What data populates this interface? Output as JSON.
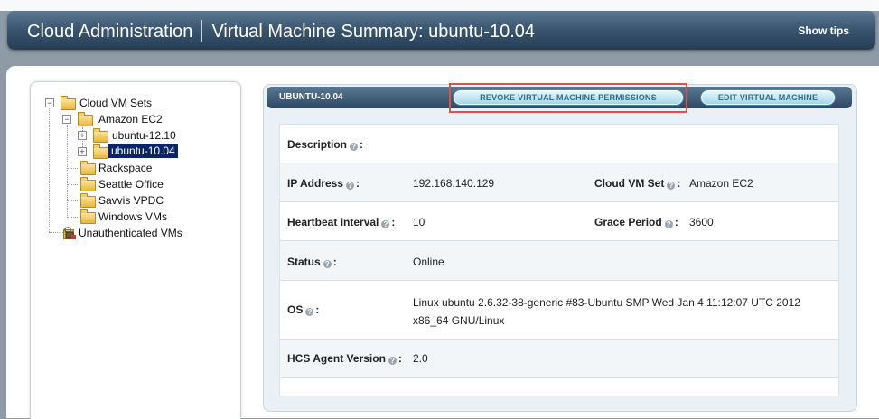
{
  "header": {
    "app_title": "Cloud Administration",
    "page_title": "Virtual Machine Summary: ubuntu-10.04",
    "show_tips": "Show tips"
  },
  "tree": {
    "cloud_vm_sets": "Cloud VM Sets",
    "amazon_ec2": "Amazon EC2",
    "ubuntu_1210": "ubuntu-12.10",
    "ubuntu_1004": "ubuntu-10.04",
    "rackspace": "Rackspace",
    "seattle_office": "Seattle Office",
    "savvis_vpdc": "Savvis VPDC",
    "windows_vms": "Windows VMs",
    "unauthenticated_vms": "Unauthenticated VMs"
  },
  "panel": {
    "title": "UBUNTU-10.04",
    "revoke_button": "REVOKE VIRTUAL MACHINE PERMISSIONS",
    "edit_button": "EDIT VIRTUAL MACHINE"
  },
  "details": {
    "description_label": "Description",
    "description_value": "",
    "ip_label": "IP Address",
    "ip_value": "192.168.140.129",
    "vmset_label": "Cloud VM Set",
    "vmset_value": "Amazon EC2",
    "heartbeat_label": "Heartbeat Interval",
    "heartbeat_value": "10",
    "grace_label": "Grace Period",
    "grace_value": "3600",
    "status_label": "Status",
    "status_value": "Online",
    "os_label": "OS",
    "os_value_line1": "Linux ubuntu 2.6.32-38-generic #83-Ubuntu SMP Wed Jan 4 11:12:07 UTC 2012",
    "os_value_line2": "x86_64 GNU/Linux",
    "agent_label": "HCS Agent Version",
    "agent_value": "2.0",
    "colon": ":"
  }
}
